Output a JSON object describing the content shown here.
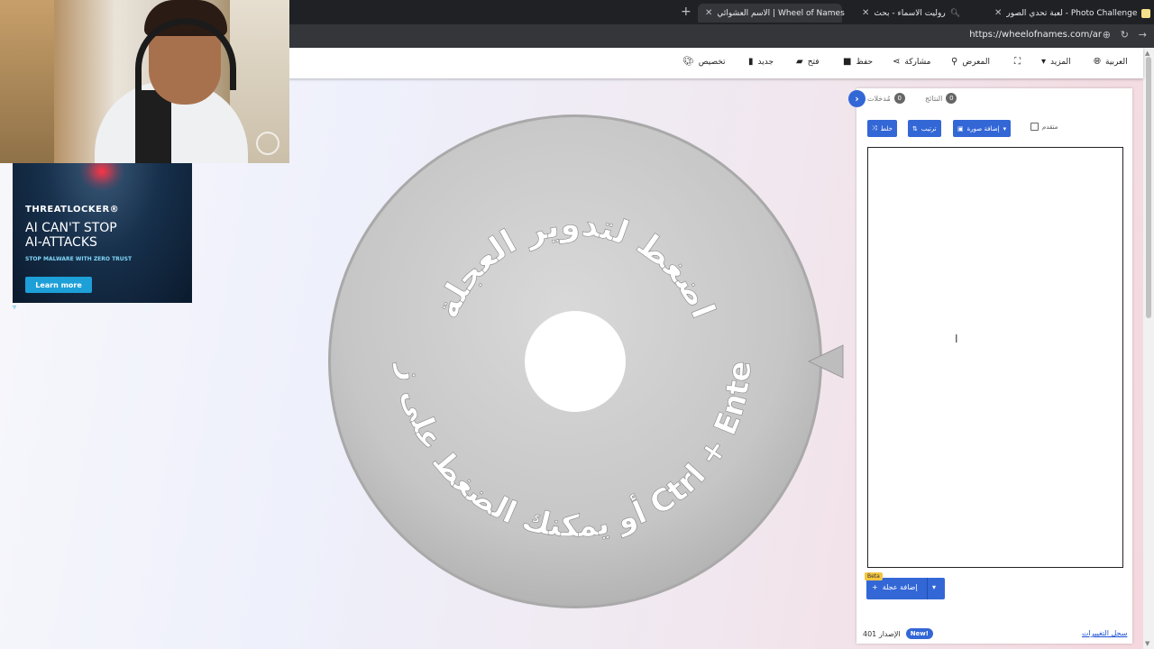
{
  "browser": {
    "tabs": [
      {
        "label": "لعبة تحدي الصور - Photo Challenge"
      },
      {
        "label": "روليت الاسماء - بحث"
      },
      {
        "label": "الاسم العشوائي | Wheel of Names"
      }
    ],
    "url": "https://wheelofnames.com/ar"
  },
  "toolbar": {
    "customize": "تخصيص",
    "new": "جديد",
    "open": "فتح",
    "save": "حفظ",
    "share": "مشاركة",
    "gallery": "المعرض",
    "more": "المزيد",
    "language": "العربية"
  },
  "ad": {
    "brand": "THREATLOCKER®",
    "headline_1": "AI CAN'T STOP",
    "headline_2": "AI-ATTACKS",
    "subline": "STOP MALWARE WITH ZERO TRUST",
    "cta": "Learn more"
  },
  "wheel": {
    "text_top": "اضغط لتدوير العجلة",
    "text_bottom": "أو يمكنك الضغط على زر Ctrl + Enter"
  },
  "panel": {
    "entries_tab": "مُدخلات",
    "entries_count": "0",
    "results_tab": "النتائج",
    "results_count": "0",
    "shuffle": "خلط",
    "sort": "ترتيب",
    "add_image": "إضافة صورة",
    "advanced": "متقدم",
    "add_wheel": "إضافة عجلة",
    "beta": "Beta",
    "version": "الإصدار 401",
    "new_badge": "New!",
    "changelog": "سجل التغييرات"
  },
  "colors": {
    "accent": "#3367d6",
    "chrome_dark": "#202124",
    "wheel_gray": "#c8c8c8"
  }
}
